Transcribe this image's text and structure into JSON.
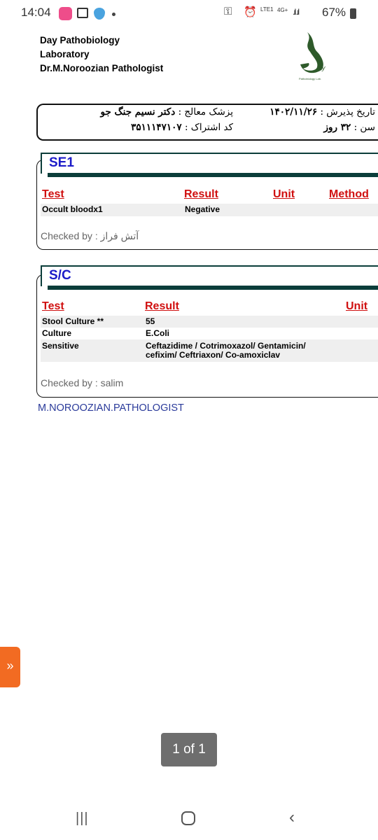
{
  "status_bar": {
    "time": "14:04",
    "battery": "67%",
    "network": "4G+",
    "sim": "LTE1"
  },
  "lab": {
    "line1": "Day Pathobiology",
    "line2": "Laboratory",
    "line3": "Dr.M.Noroozian Pathologist",
    "logo_text": "Day Pathobiology Lab."
  },
  "patient": {
    "doctor_label": "پزشک معالج :",
    "doctor_value": "دکتر نسیم جنگ جو",
    "code_label": "کد اشتراک :",
    "code_value": "۳۵۱۱۱۴۷۱۰۷",
    "date_label": "تاریخ پذیرش :",
    "date_value": "۱۴۰۲/۱۱/۲۶",
    "age_label": "سن :",
    "age_value": "۳۲ روز"
  },
  "sections": [
    {
      "title": "SE1",
      "headers": [
        "Test",
        "Result",
        "Unit",
        "Method"
      ],
      "rows": [
        {
          "test": "Occult bloodx1",
          "result": "Negative"
        }
      ],
      "checked_by": "Checked by : آتش فراز"
    },
    {
      "title": "S/C",
      "headers": [
        "Test",
        "Result",
        "Unit"
      ],
      "rows": [
        {
          "test": "Stool Culture **",
          "result": "55"
        },
        {
          "test": "Culture",
          "result": "E.Coli"
        },
        {
          "test": "Sensitive",
          "result": "Ceftazidime / Cotrimoxazol/ Gentamicin/",
          "result2": "cefixim/ Ceftriaxon/ Co-amoxiclav"
        }
      ],
      "checked_by": "Checked by : salim"
    }
  ],
  "footer": "M.NOROOZIAN.PATHOLOGIST",
  "pager": "1 of 1",
  "side_button": "»",
  "colors": {
    "header_red": "#d01010",
    "section_title": "#1b1bc8",
    "bar": "#0b3d3a",
    "side_button": "#f26b22"
  }
}
